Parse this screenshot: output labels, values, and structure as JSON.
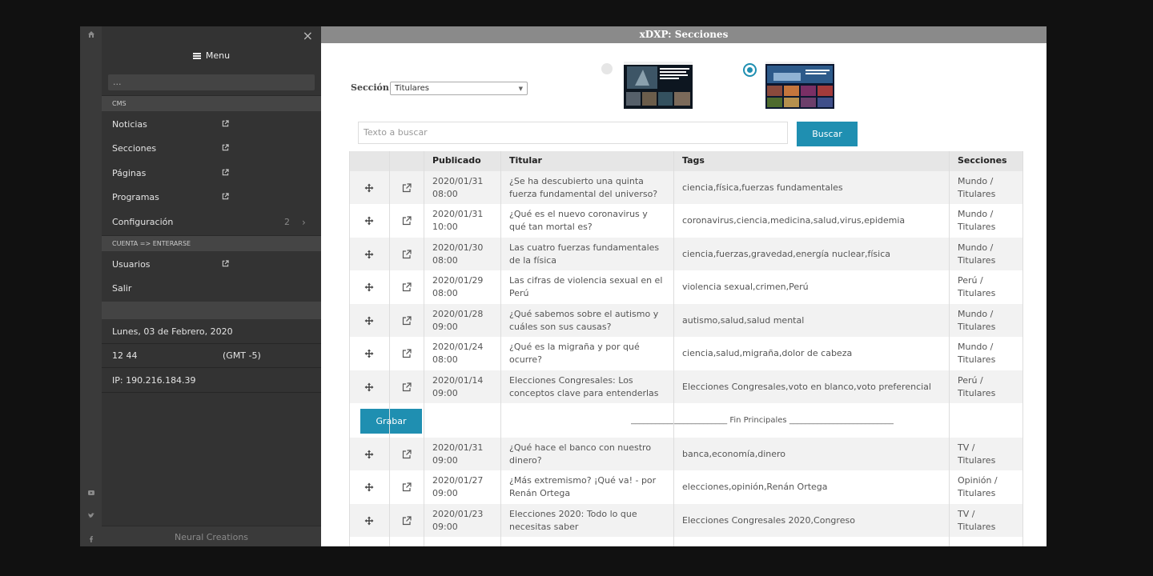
{
  "sidebar": {
    "menu_label": "Menu",
    "search_placeholder": "...",
    "sections": [
      {
        "head": "CMS"
      },
      {
        "head": "CUENTA => ENTERARSE"
      }
    ],
    "cms_items": [
      {
        "label": "Noticias"
      },
      {
        "label": "Secciones"
      },
      {
        "label": "Páginas"
      },
      {
        "label": "Programas"
      },
      {
        "label": "Configuración",
        "badge": "2"
      }
    ],
    "account_items": [
      {
        "label": "Usuarios"
      },
      {
        "label": "Salir"
      }
    ],
    "date": "Lunes, 03 de Febrero, 2020",
    "time": "12 44",
    "timezone": "(GMT -5)",
    "ip": "IP: 190.216.184.39",
    "footer": "Neural Creations"
  },
  "main": {
    "title": "xDXP: Secciones",
    "section_label": "Sección",
    "section_value": "Titulares",
    "layout_options": [
      {
        "selected": false,
        "thumb_headline": "Descubren nuevo especie de oso planeta..."
      },
      {
        "selected": true
      }
    ],
    "search_placeholder": "Texto a buscar",
    "search_button": "Buscar",
    "save_button": "Grabar",
    "divider_text": "________________________ Fin Principales __________________________",
    "columns": [
      "Publicado",
      "Titular",
      "Tags",
      "Secciones"
    ],
    "rows_main": [
      {
        "date": "2020/01/31 08:00",
        "title": "¿Se ha descubierto una quinta fuerza fundamental del universo?",
        "tags": "ciencia,física,fuerzas fundamentales",
        "sections": "Mundo / Titulares"
      },
      {
        "date": "2020/01/31 10:00",
        "title": "¿Qué es el nuevo coronavirus y qué tan mortal es?",
        "tags": "coronavirus,ciencia,medicina,salud,virus,epidemia",
        "sections": "Mundo / Titulares"
      },
      {
        "date": "2020/01/30 08:00",
        "title": "Las cuatro fuerzas fundamentales de la física",
        "tags": "ciencia,fuerzas,gravedad,energía nuclear,física",
        "sections": "Mundo / Titulares"
      },
      {
        "date": "2020/01/29 08:00",
        "title": "Las cifras de violencia sexual en el Perú",
        "tags": "violencia sexual,crimen,Perú",
        "sections": "Perú / Titulares"
      },
      {
        "date": "2020/01/28 09:00",
        "title": "¿Qué sabemos sobre el autismo y cuáles son sus causas?",
        "tags": "autismo,salud,salud mental",
        "sections": "Mundo / Titulares"
      },
      {
        "date": "2020/01/24 08:00",
        "title": "¿Qué es la migraña y por qué ocurre?",
        "tags": "ciencia,salud,migraña,dolor de cabeza",
        "sections": "Mundo / Titulares"
      },
      {
        "date": "2020/01/14 09:00",
        "title": "Elecciones Congresales: Los conceptos clave para entenderlas",
        "tags": "Elecciones Congresales,voto en blanco,voto preferencial",
        "sections": "Perú / Titulares"
      }
    ],
    "rows_rest": [
      {
        "date": "2020/01/31 09:00",
        "title": "¿Qué hace el banco con nuestro dinero?",
        "tags": "banca,economía,dinero",
        "sections": "TV / Titulares"
      },
      {
        "date": "2020/01/27 09:00",
        "title": "¿Más extremismo? ¡Qué va! - por Renán Ortega",
        "tags": "elecciones,opinión,Renán Ortega",
        "sections": "Opinión / Titulares"
      },
      {
        "date": "2020/01/23 09:00",
        "title": "Elecciones 2020: Todo lo que necesitas saber",
        "tags": "Elecciones Congresales 2020,Congreso",
        "sections": "TV / Titulares"
      }
    ],
    "colors": {
      "accent": "#1f8fb1",
      "titlebar": "#8a8a8a",
      "sidebar": "#333333"
    }
  }
}
